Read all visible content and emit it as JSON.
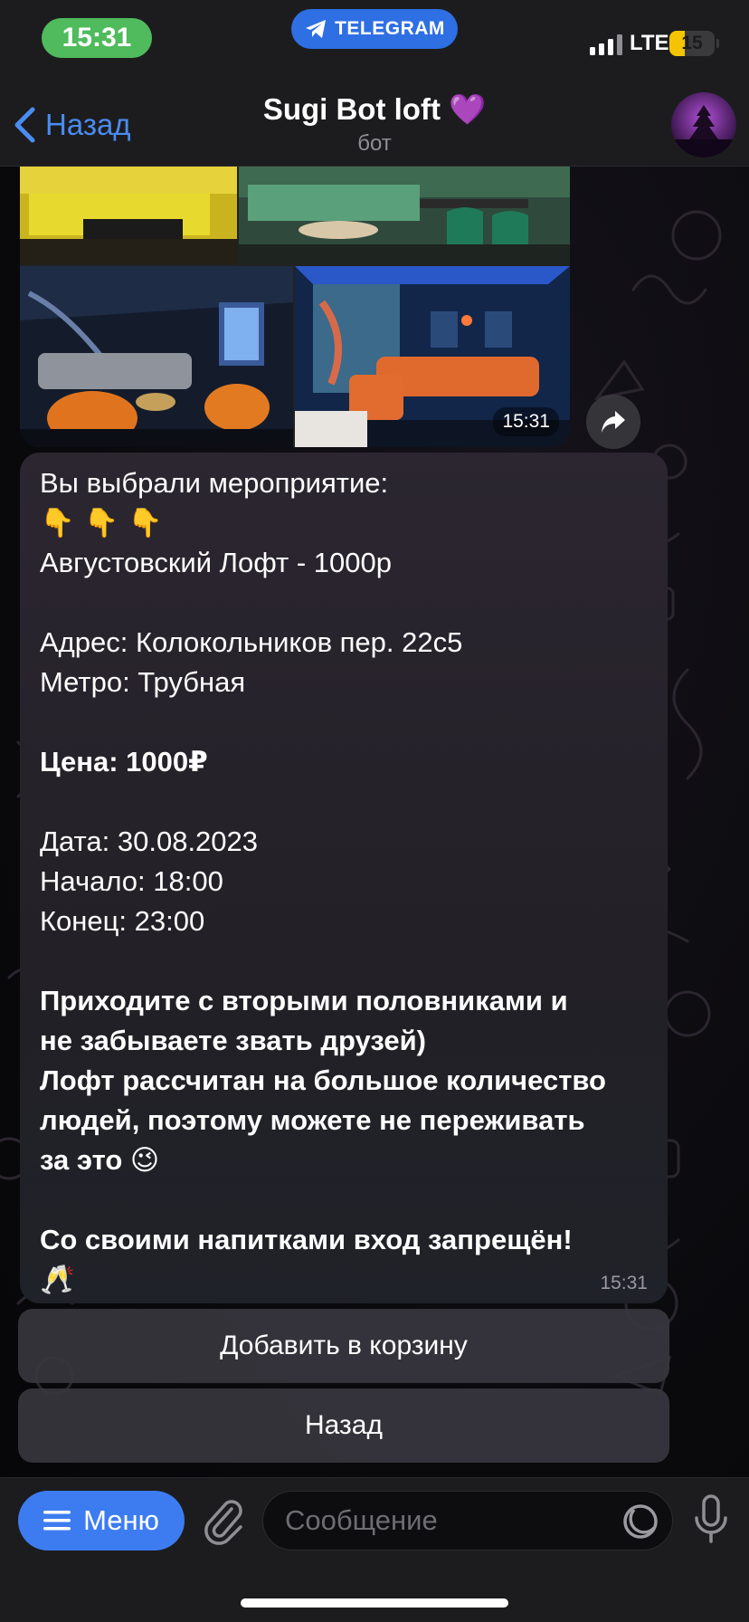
{
  "status_bar": {
    "time": "15:31",
    "telegram_label": "TELEGRAM",
    "network": "LTE",
    "battery_level": "15",
    "battery_fraction": 0.15
  },
  "nav": {
    "back_label": "Назад",
    "title": "Sugi Bot loft 💜",
    "subtitle": "бот"
  },
  "media": {
    "photos": [
      {
        "name": "yellow-sofa-room"
      },
      {
        "name": "green-lounge-room"
      },
      {
        "name": "cinema-room-orange-beanbags"
      },
      {
        "name": "blue-neon-room-orange-sofa"
      }
    ],
    "time": "15:31"
  },
  "message": {
    "intro": "Вы выбрали мероприятие:",
    "pointing_emoji": [
      "👇",
      "👇",
      "👇"
    ],
    "event": "Августовский Лофт - 1000р",
    "address": "Адрес: Колокольников пер. 22с5",
    "metro": "Метро: Трубная",
    "price": "Цена: 1000₽",
    "date": "Дата: 30.08.2023",
    "start": "Начало: 18:00",
    "end": "Конец: 23:00",
    "invite_1": "Приходите с вторыми половниками и",
    "invite_2": "не забываете звать друзей)",
    "invite_3": "Лофт рассчитан на большое количество",
    "invite_4": "людей, поэтому можете не переживать",
    "invite_5": "за это 😉",
    "rule": "Со своими напитками вход запрещён!",
    "rule_emoji": "🥂",
    "time": "15:31"
  },
  "keyboard": {
    "add_to_cart": "Добавить в корзину",
    "back": "Назад"
  },
  "composer": {
    "menu_label": "Меню",
    "placeholder": "Сообщение"
  },
  "colors": {
    "accent": "#3d7cf0",
    "link": "#4a8cf0",
    "status_green": "#4fbb5c",
    "battery_yellow": "#f5c400"
  }
}
